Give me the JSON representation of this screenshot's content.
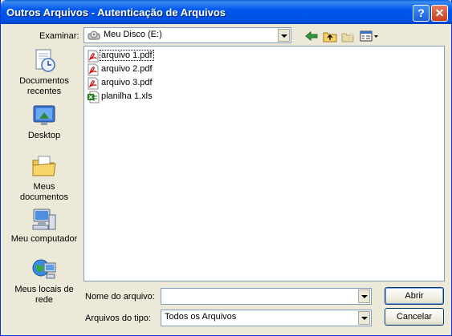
{
  "window": {
    "title": "Outros Arquivos - Autenticação de Arquivos"
  },
  "titlebar_buttons": {
    "help": "?",
    "close": "✕"
  },
  "lookin": {
    "label": "Examinar:",
    "value": "Meu Disco (E:)",
    "icon": "drive-icon"
  },
  "toolbar": {
    "back": "back-icon",
    "up": "up-folder-icon",
    "new_folder": "new-folder-icon",
    "views": "views-menu-icon"
  },
  "places": [
    {
      "label": "Documentos\nrecentes",
      "icon": "recent-documents-icon"
    },
    {
      "label": "Desktop",
      "icon": "desktop-icon"
    },
    {
      "label": "Meus\ndocumentos",
      "icon": "my-documents-icon"
    },
    {
      "label": "Meu computador",
      "icon": "my-computer-icon"
    },
    {
      "label": "Meus locais de\nrede",
      "icon": "network-places-icon"
    }
  ],
  "files": [
    {
      "name": "arquivo 1.pdf",
      "type": "pdf",
      "selected": true
    },
    {
      "name": "arquivo 2.pdf",
      "type": "pdf",
      "selected": false
    },
    {
      "name": "arquivo 3.pdf",
      "type": "pdf",
      "selected": false
    },
    {
      "name": "planilha 1.xls",
      "type": "xls",
      "selected": false
    }
  ],
  "filename": {
    "label": "Nome do arquivo:",
    "value": ""
  },
  "filetype": {
    "label": "Arquivos do tipo:",
    "value": "Todos os Arquivos"
  },
  "buttons": {
    "open": "Abrir",
    "cancel": "Cancelar"
  },
  "colors": {
    "titlebar": "#0058ee",
    "dialog_bg": "#ECE9D8",
    "pdf_red": "#cc0000",
    "xls_green": "#1d7a1d"
  }
}
